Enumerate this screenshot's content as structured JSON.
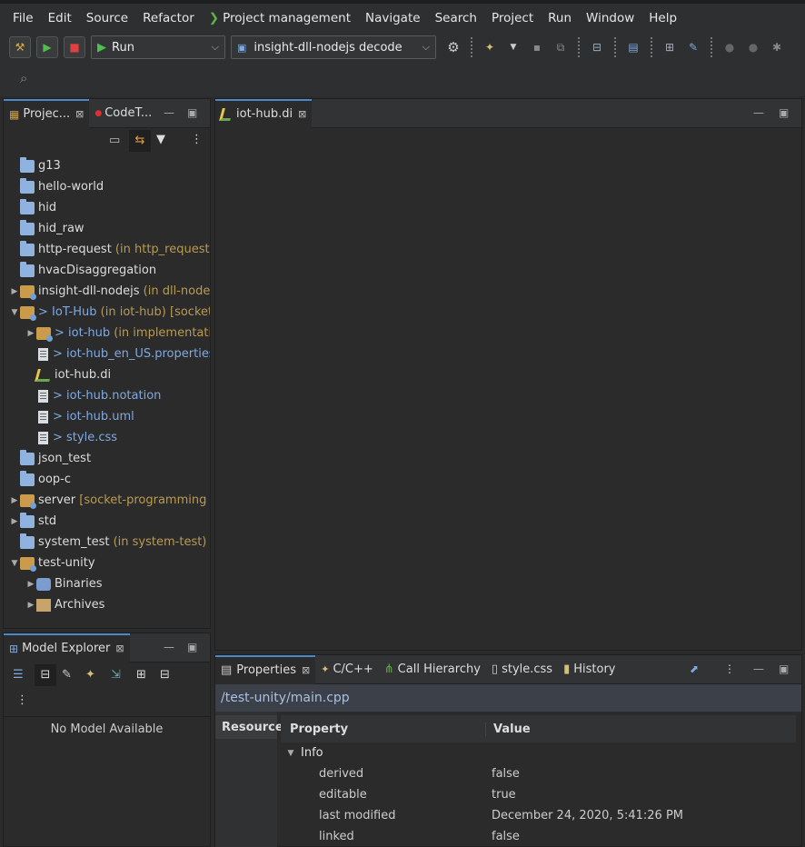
{
  "menu": [
    "File",
    "Edit",
    "Source",
    "Refactor",
    "Project management",
    "Navigate",
    "Search",
    "Project",
    "Run",
    "Window",
    "Help"
  ],
  "toolbar": {
    "run_label": "Run",
    "config_label": "insight-dll-nodejs decode"
  },
  "project_panel": {
    "tabs": [
      {
        "label": "Projec...",
        "active": true
      },
      {
        "label": "CodeT...",
        "active": false
      }
    ],
    "tree": [
      {
        "indent": 0,
        "twisty": "",
        "icon": "folder",
        "name": "g13",
        "extra": ""
      },
      {
        "indent": 0,
        "twisty": "",
        "icon": "folder",
        "name": "hello-world",
        "extra": ""
      },
      {
        "indent": 0,
        "twisty": "",
        "icon": "folder",
        "name": "hid",
        "extra": ""
      },
      {
        "indent": 0,
        "twisty": "",
        "icon": "folder",
        "name": "hid_raw",
        "extra": ""
      },
      {
        "indent": 0,
        "twisty": "",
        "icon": "folder",
        "name": "http-request",
        "extra": " (in http_requests)"
      },
      {
        "indent": 0,
        "twisty": "",
        "icon": "folder",
        "name": "hvacDisaggregation",
        "extra": ""
      },
      {
        "indent": 0,
        "twisty": "▶",
        "icon": "proj",
        "name": "insight-dll-nodejs",
        "extra": " (in dll-nodejs) [e"
      },
      {
        "indent": 0,
        "twisty": "▼",
        "icon": "proj",
        "name": "> IoT-Hub",
        "extra": " (in iot-hub) [socket-progr",
        "blue": true
      },
      {
        "indent": 1,
        "twisty": "▶",
        "icon": "proj",
        "name": "> iot-hub",
        "extra": " (in implementation) [",
        "blue": true
      },
      {
        "indent": 1,
        "twisty": "",
        "icon": "file",
        "name": "> iot-hub_en_US.properties",
        "extra": "",
        "blue": true
      },
      {
        "indent": 1,
        "twisty": "",
        "icon": "di",
        "name": "iot-hub.di",
        "extra": ""
      },
      {
        "indent": 1,
        "twisty": "",
        "icon": "file",
        "name": "> iot-hub.notation",
        "extra": "",
        "blue": true
      },
      {
        "indent": 1,
        "twisty": "",
        "icon": "file",
        "name": "> iot-hub.uml",
        "extra": "",
        "blue": true
      },
      {
        "indent": 1,
        "twisty": "",
        "icon": "file",
        "name": "> style.css",
        "extra": "",
        "blue": true
      },
      {
        "indent": 0,
        "twisty": "",
        "icon": "folder",
        "name": "json_test",
        "extra": ""
      },
      {
        "indent": 0,
        "twisty": "",
        "icon": "folder",
        "name": "oop-c",
        "extra": ""
      },
      {
        "indent": 0,
        "twisty": "▶",
        "icon": "proj",
        "name": "server",
        "extra": " [socket-programming maste"
      },
      {
        "indent": 0,
        "twisty": "▶",
        "icon": "folder",
        "name": "std",
        "extra": ""
      },
      {
        "indent": 0,
        "twisty": "",
        "icon": "folder",
        "name": "system_test",
        "extra": " (in system-test)"
      },
      {
        "indent": 0,
        "twisty": "▼",
        "icon": "proj",
        "name": "test-unity",
        "extra": ""
      },
      {
        "indent": 1,
        "twisty": "▶",
        "icon": "bin",
        "name": "Binaries",
        "extra": ""
      },
      {
        "indent": 1,
        "twisty": "▶",
        "icon": "arc",
        "name": "Archives",
        "extra": ""
      }
    ]
  },
  "editor": {
    "tab_label": "iot-hub.di"
  },
  "model_explorer": {
    "tab_label": "Model Explorer",
    "empty_text": "No Model Available"
  },
  "properties": {
    "tabs": [
      "Properties",
      "C/C++",
      "Call Hierarchy",
      "style.css",
      "History"
    ],
    "path": "/test-unity/main.cpp",
    "side_tab": "Resource",
    "col_property": "Property",
    "col_value": "Value",
    "group": "Info",
    "rows": [
      {
        "name": "derived",
        "value": "false"
      },
      {
        "name": "editable",
        "value": "true"
      },
      {
        "name": "last modified",
        "value": "December 24, 2020, 5:41:26 PM"
      },
      {
        "name": "linked",
        "value": "false"
      }
    ]
  }
}
